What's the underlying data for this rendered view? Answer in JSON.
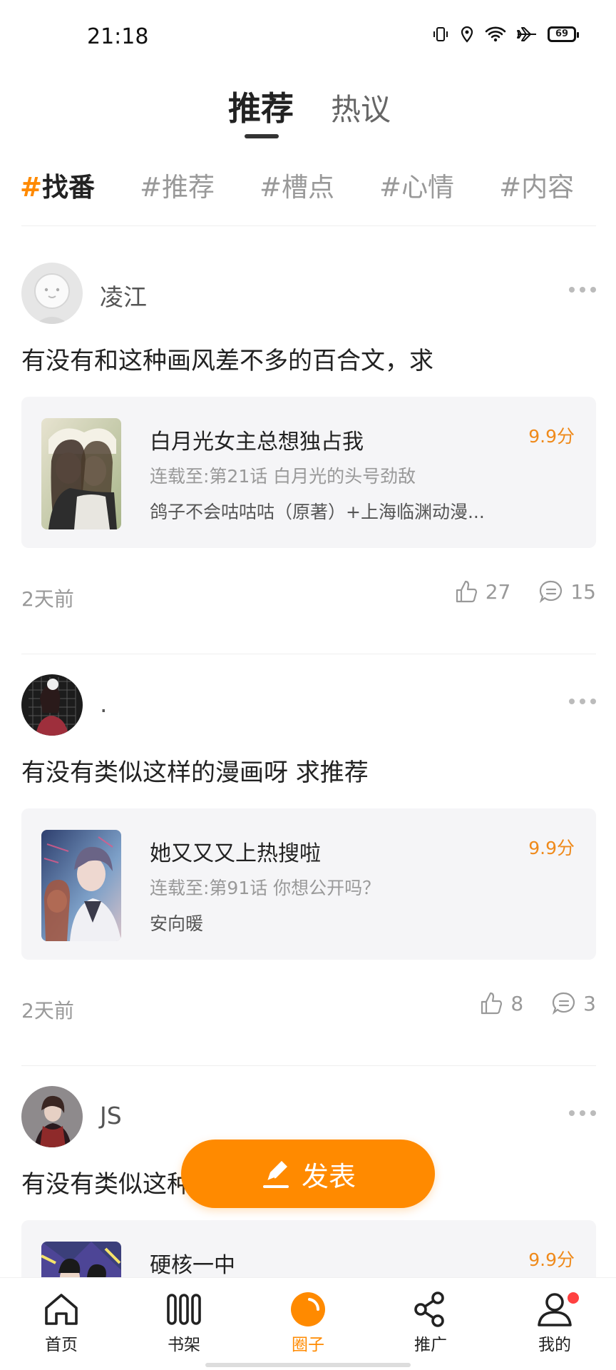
{
  "status_bar": {
    "time": "21:18",
    "battery": "69"
  },
  "top_tabs": [
    {
      "label": "推荐",
      "active": true
    },
    {
      "label": "热议",
      "active": false
    }
  ],
  "hashtags": [
    {
      "hash": "#",
      "label": "找番",
      "active": true
    },
    {
      "hash": "#",
      "label": "推荐",
      "active": false
    },
    {
      "hash": "#",
      "label": "槽点",
      "active": false
    },
    {
      "hash": "#",
      "label": "心情",
      "active": false
    },
    {
      "hash": "#",
      "label": "内容",
      "active": false
    }
  ],
  "posts": [
    {
      "username": "凌江",
      "text": "有没有和这种画风差不多的百合文，求",
      "book": {
        "title": "白月光女主总想独占我",
        "progress": "连载至:第21话 白月光的头号劲敌",
        "author": "鸽子不会咕咕咕（原著）+上海临渊动漫...",
        "score": "9.9分"
      },
      "time": "2天前",
      "likes": "27",
      "comments": "15"
    },
    {
      "username": ".",
      "text": "有没有类似这样的漫画呀 求推荐",
      "book": {
        "title": "她又又又上热搜啦",
        "progress": "连载至:第91话 你想公开吗？",
        "author": "安向暖",
        "score": "9.9分"
      },
      "time": "2天前",
      "likes": "8",
      "comments": "3"
    },
    {
      "username": "JS",
      "text": "有没有类似这种",
      "book": {
        "title": "硬核一中",
        "score": "9.9分"
      }
    }
  ],
  "publish_button": {
    "label": "发表"
  },
  "bottom_nav": [
    {
      "label": "首页",
      "icon": "home-icon"
    },
    {
      "label": "书架",
      "icon": "bookshelf-icon"
    },
    {
      "label": "圈子",
      "icon": "circle-icon",
      "active": true
    },
    {
      "label": "推广",
      "icon": "share-icon"
    },
    {
      "label": "我的",
      "icon": "profile-icon",
      "badge": true
    }
  ],
  "colors": {
    "accent": "#ff8a00",
    "score": "#ef8a1b",
    "badge": "#ff4040"
  }
}
